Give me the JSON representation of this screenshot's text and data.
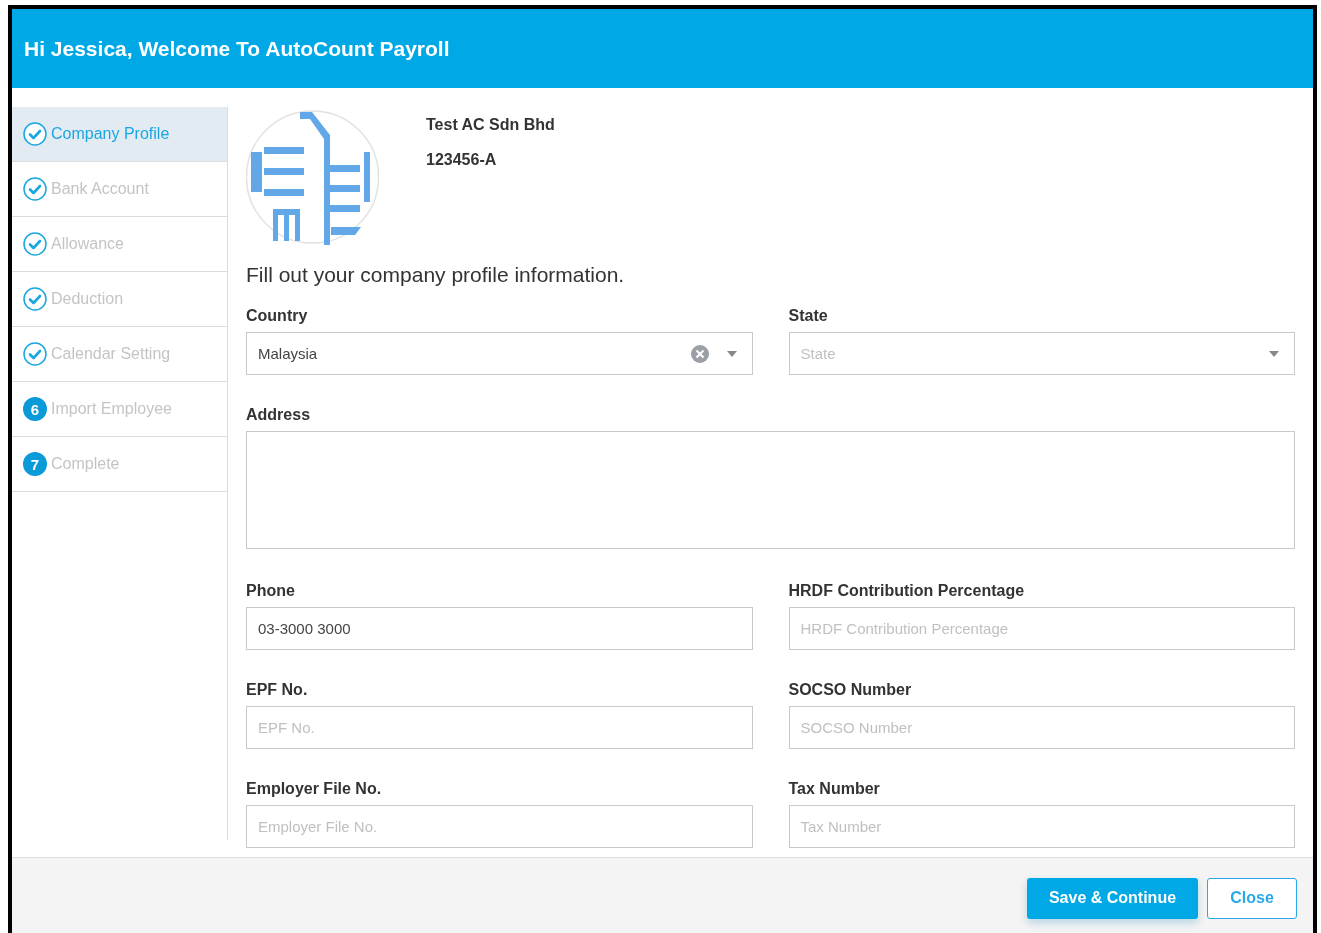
{
  "window": {
    "title": "Hi Jessica, Welcome To AutoCount Payroll"
  },
  "steps": [
    {
      "label": "Company Profile",
      "kind": "done",
      "selected": true
    },
    {
      "label": "Bank Account",
      "kind": "done",
      "selected": false
    },
    {
      "label": "Allowance",
      "kind": "done",
      "selected": false
    },
    {
      "label": "Deduction",
      "kind": "done",
      "selected": false
    },
    {
      "label": "Calendar Setting",
      "kind": "done",
      "selected": false
    },
    {
      "label": "Import Employee",
      "kind": "number",
      "number": "6",
      "selected": false
    },
    {
      "label": "Complete",
      "kind": "number",
      "number": "7",
      "selected": false
    }
  ],
  "company": {
    "name": "Test AC Sdn Bhd",
    "registration": "123456-A"
  },
  "heading": "Fill out your company profile information.",
  "fields": [
    {
      "label": "Country",
      "kind": "select",
      "value": "Malaysia",
      "clearable": true
    },
    {
      "label": "State",
      "kind": "select",
      "placeholder": "State",
      "clearable": false
    },
    {
      "label": "Address",
      "kind": "textarea"
    },
    {
      "label": "Phone",
      "kind": "text",
      "value": "03-3000 3000"
    },
    {
      "label": "HRDF Contribution Percentage",
      "kind": "text",
      "placeholder": "HRDF Contribution Percentage"
    },
    {
      "label": "EPF No.",
      "kind": "text",
      "placeholder": "EPF No."
    },
    {
      "label": "SOCSO Number",
      "kind": "text",
      "placeholder": "SOCSO Number"
    },
    {
      "label": "Employer File No.",
      "kind": "text",
      "placeholder": "Employer File No."
    },
    {
      "label": "Tax Number",
      "kind": "text",
      "placeholder": "Tax Number"
    }
  ],
  "buttons": [
    {
      "label": "Save & Continue",
      "kind": "primary"
    },
    {
      "label": "Close",
      "kind": "secondary"
    }
  ]
}
